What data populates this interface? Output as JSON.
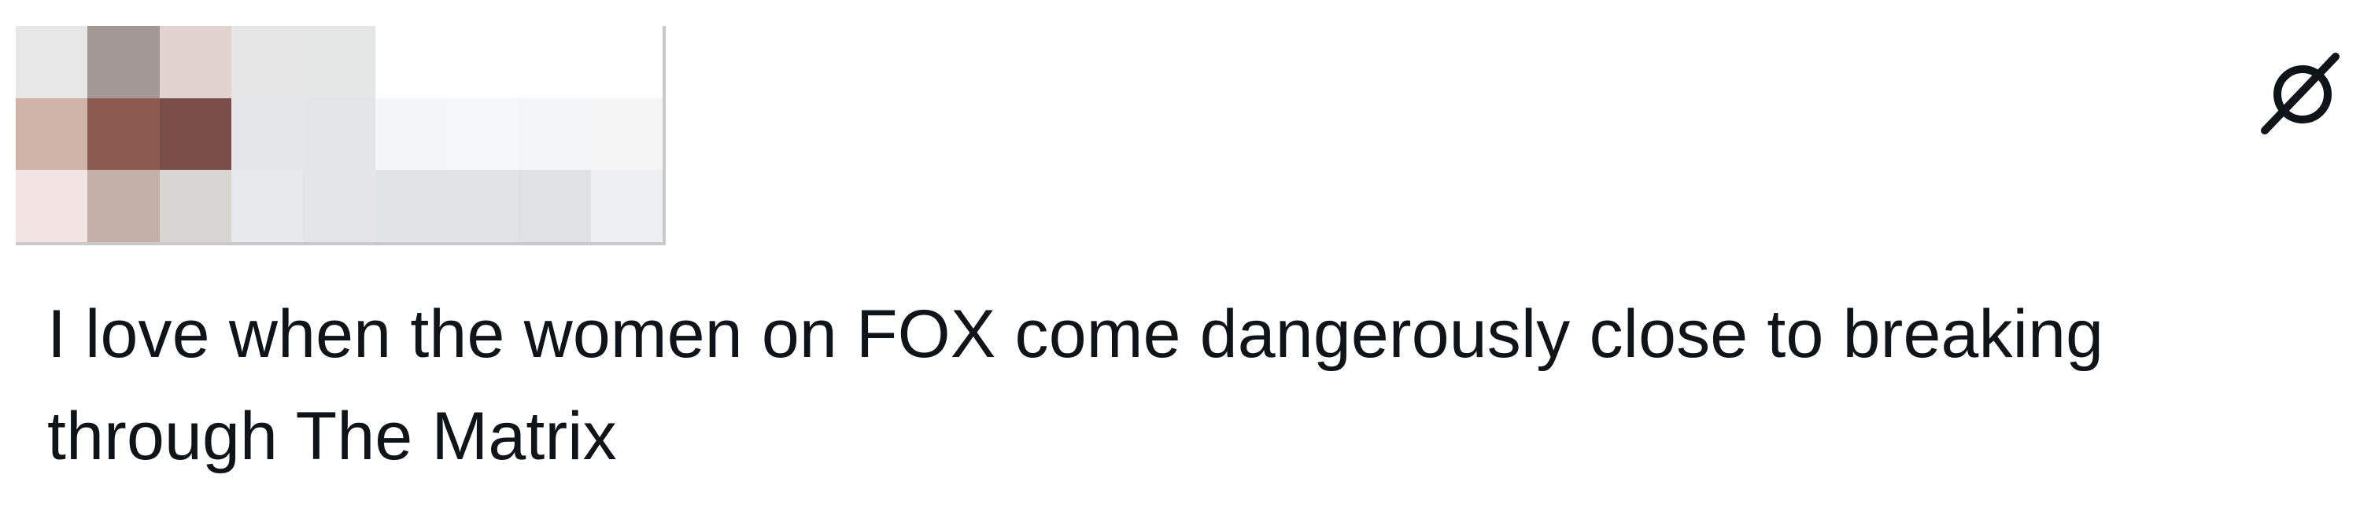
{
  "tweet": {
    "text": "I love when the women on FOX come dangerously close to breaking through The Matrix",
    "text_color": "#0f1419"
  },
  "header": {
    "redacted_pixels": [
      [
        "#e7e7e7",
        "#a39896",
        "#e1d2cf",
        "#e6e6e6",
        "#e5e6e6",
        "#ffffff",
        "#ffffff",
        "#ffffff",
        "#ffffff"
      ],
      [
        "#cfb3a8",
        "#8c5b50",
        "#7a4e48",
        "#e4e6e8",
        "#e3e4e5",
        "#f3f5f6",
        "#f6f7f8",
        "#f4f5f6",
        "#f5f5f6"
      ],
      [
        "#f1e4e2",
        "#c3b1a9",
        "#d9d5d2",
        "#e7e9eb",
        "#e3e5e8",
        "#e1e4e7",
        "#e1e4e7",
        "#dfe2e5",
        "#eeeff1"
      ]
    ]
  },
  "icons": {
    "grok": "grok-icon"
  }
}
